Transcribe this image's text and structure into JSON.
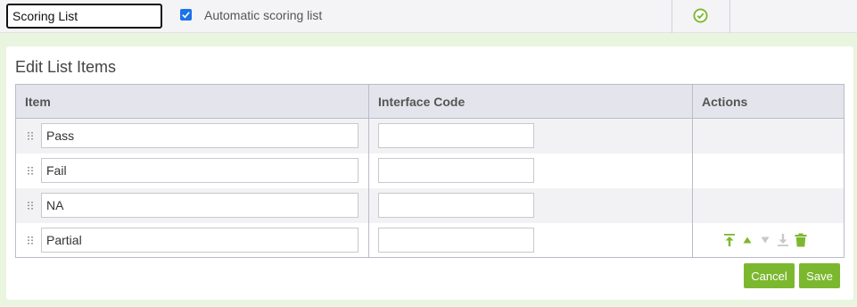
{
  "toolbar": {
    "list_name_value": "Scoring List",
    "automatic_checkbox_checked": true,
    "automatic_label": "Automatic scoring list",
    "status_icon": "check-circle-icon"
  },
  "card": {
    "title": "Edit List Items",
    "columns": [
      "Item",
      "Interface Code",
      "Actions"
    ],
    "rows": [
      {
        "item": "Pass",
        "interface_code": ""
      },
      {
        "item": "Fail",
        "interface_code": ""
      },
      {
        "item": "NA",
        "interface_code": ""
      },
      {
        "item": "Partial",
        "interface_code": ""
      }
    ],
    "row_actions": [
      "move-to-top-icon",
      "move-up-icon",
      "move-down-icon",
      "move-to-bottom-icon",
      "trash-icon"
    ],
    "buttons": {
      "cancel_label": "Cancel",
      "save_label": "Save"
    }
  },
  "colors": {
    "accent_green": "#7cb82f",
    "disabled_gray": "#c8c8c8",
    "header_bg": "#e4e5ec",
    "page_bg": "#e9f5df"
  }
}
